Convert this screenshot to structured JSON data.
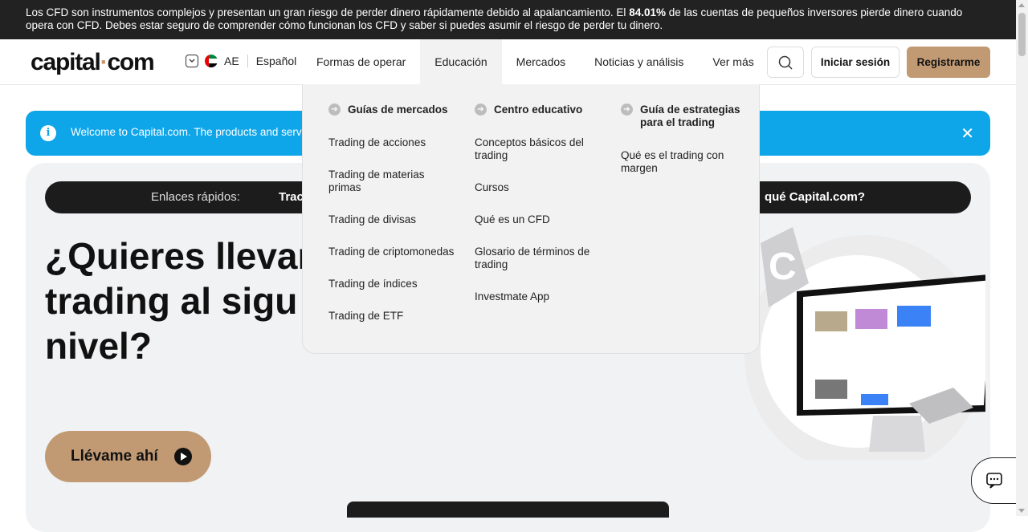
{
  "risk_warning": {
    "text_before": "Los CFD son instrumentos complejos y presentan un gran riesgo de perder dinero rápidamente debido al apalancamiento. El ",
    "percent": "84.01%",
    "text_after": " de las cuentas de pequeños inversores pierde dinero cuando opera con CFD. Debes estar seguro de comprender cómo funcionan los CFD y saber si puedes asumir el riesgo de perder tu dinero."
  },
  "header": {
    "logo_part1": "capital",
    "logo_dot": "·",
    "logo_part2": "com",
    "region": "AE",
    "language": "Español",
    "nav": [
      "Formas de operar",
      "Educación",
      "Mercados",
      "Noticias y análisis",
      "Ver más"
    ],
    "login": "Iniciar sesión",
    "signup": "Registrarme"
  },
  "info_banner": {
    "icon": "info-icon",
    "text": "Welcome to Capital.com. The products and servi"
  },
  "quick_links": {
    "label": "Enlaces rápidos:",
    "first": "Trac",
    "last": "qué Capital.com?"
  },
  "hero": {
    "title": "¿Quieres llevar\ntrading al sigu\nnivel?",
    "cta": "Llévame ahí"
  },
  "mega_menu": {
    "columns": [
      {
        "heading": "Guías de mercados",
        "items": [
          "Trading de acciones",
          "Trading de materias primas",
          "Trading de divisas",
          "Trading de criptomonedas",
          "Trading de índices",
          "Trading de ETF"
        ]
      },
      {
        "heading": "Centro educativo",
        "items": [
          "Conceptos básicos del trading",
          "Cursos",
          "Qué es un CFD",
          "Glosario de términos de trading",
          "Investmate App"
        ]
      },
      {
        "heading": "Guía de estrategias para el trading",
        "items": [
          "Qué es el trading con margen"
        ]
      }
    ]
  }
}
